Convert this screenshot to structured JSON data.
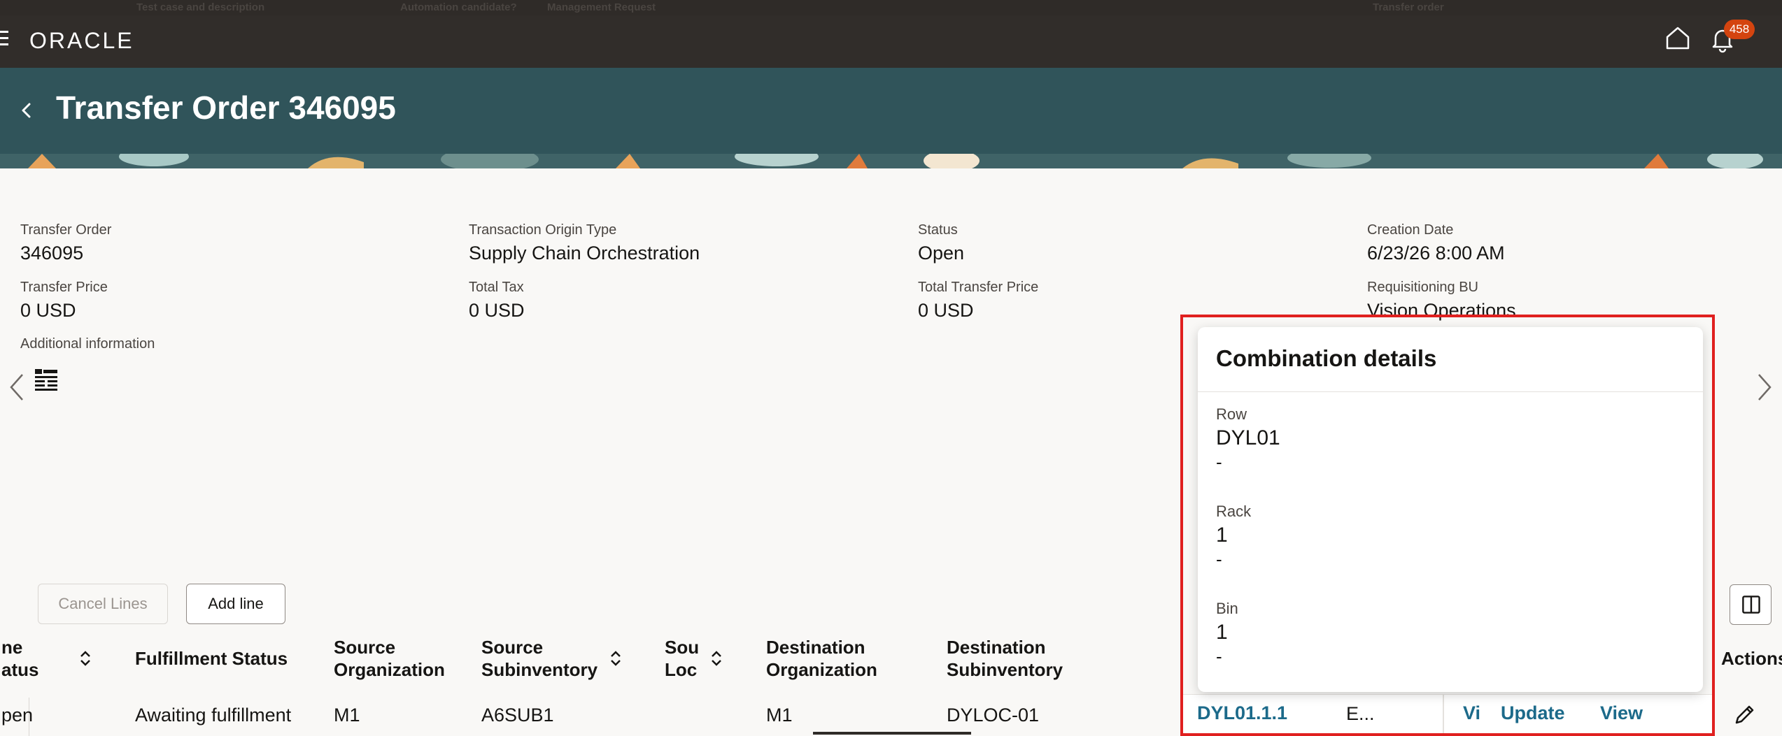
{
  "top_strip": {
    "items": [
      "Test case and description",
      "Automation candidate?",
      "Management Request",
      "Transfer order"
    ]
  },
  "appbar": {
    "logo": "ORACLE",
    "notification_count": "458"
  },
  "header": {
    "title": "Transfer Order 346095"
  },
  "details": {
    "transfer_order": {
      "label": "Transfer Order",
      "value": "346095"
    },
    "origin_type": {
      "label": "Transaction Origin Type",
      "value": "Supply Chain Orchestration"
    },
    "status": {
      "label": "Status",
      "value": "Open"
    },
    "creation_date": {
      "label": "Creation Date",
      "value": "6/23/26 8:00 AM"
    },
    "transfer_price": {
      "label": "Transfer Price",
      "value": "0 USD"
    },
    "total_tax": {
      "label": "Total Tax",
      "value": "0 USD"
    },
    "total_transfer_price": {
      "label": "Total Transfer Price",
      "value": "0 USD"
    },
    "requisitioning_bu": {
      "label": "Requisitioning BU",
      "value": "Vision Operations"
    },
    "additional_info": {
      "label": "Additional information"
    }
  },
  "actions": {
    "cancel_lines": "Cancel Lines",
    "add_line": "Add line"
  },
  "table": {
    "headers": {
      "line_status": [
        "ne",
        "atus"
      ],
      "fulfillment_status": "Fulfillment Status",
      "source_org": [
        "Source",
        "Organization"
      ],
      "source_subinv": [
        "Source",
        "Subinventory"
      ],
      "source_loc": [
        "Sou",
        "Loc"
      ],
      "dest_org": [
        "Destination",
        "Organization"
      ],
      "dest_subinv": [
        "Destination",
        "Subinventory"
      ],
      "actions": "Actions"
    },
    "row": {
      "line_status": "pen",
      "fulfillment_status": "Awaiting fulfillment",
      "source_org": "M1",
      "source_subinv": "A6SUB1",
      "dest_org": "M1",
      "dest_subinv": "DYLOC-01",
      "locator": "DYL01.1.1",
      "truncated": "E...",
      "link_vi": "Vi",
      "link_update": "Update",
      "link_view": "View"
    }
  },
  "popup": {
    "title": "Combination details",
    "segments": [
      {
        "label": "Row",
        "value": "DYL01",
        "desc": "-"
      },
      {
        "label": "Rack",
        "value": "1",
        "desc": "-"
      },
      {
        "label": "Bin",
        "value": "1",
        "desc": "-"
      }
    ]
  },
  "colors": {
    "appbar": "#312d2a",
    "titlebar": "#30545a",
    "badge": "#d4440f",
    "link": "#1c6a8a",
    "highlight": "#e0201f"
  }
}
